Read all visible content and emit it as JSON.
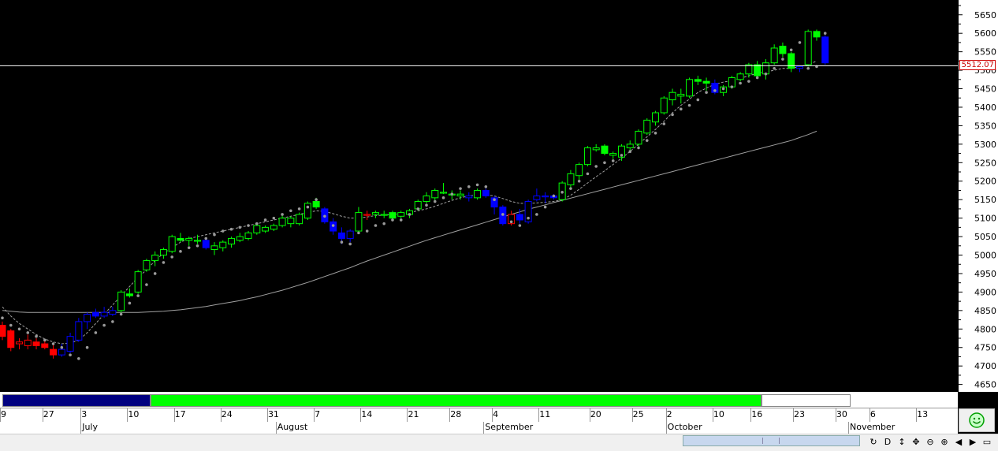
{
  "chart_data": {
    "type": "candlestick",
    "price_axis": {
      "ticks": [
        4650,
        4700,
        4750,
        4800,
        4850,
        4900,
        4950,
        5000,
        5050,
        5100,
        5150,
        5200,
        5250,
        5300,
        5350,
        5400,
        5450,
        5500,
        5550,
        5600,
        5650
      ],
      "min": 4630,
      "max": 5690
    },
    "current_price": 5512.07,
    "current_price_label": "5512.07",
    "candles": [
      {
        "o": 4810,
        "h": 4820,
        "l": 4770,
        "c": 4780,
        "color": "red"
      },
      {
        "o": 4795,
        "h": 4800,
        "l": 4740,
        "c": 4750,
        "color": "red"
      },
      {
        "o": 4760,
        "h": 4775,
        "l": 4745,
        "c": 4765,
        "color": "red"
      },
      {
        "o": 4755,
        "h": 4785,
        "l": 4745,
        "c": 4770,
        "color": "red"
      },
      {
        "o": 4765,
        "h": 4775,
        "l": 4745,
        "c": 4755,
        "color": "red"
      },
      {
        "o": 4760,
        "h": 4770,
        "l": 4745,
        "c": 4750,
        "color": "red"
      },
      {
        "o": 4745,
        "h": 4760,
        "l": 4720,
        "c": 4730,
        "color": "red"
      },
      {
        "o": 4730,
        "h": 4760,
        "l": 4725,
        "c": 4745,
        "color": "blue"
      },
      {
        "o": 4740,
        "h": 4790,
        "l": 4735,
        "c": 4780,
        "color": "blue"
      },
      {
        "o": 4770,
        "h": 4830,
        "l": 4765,
        "c": 4820,
        "color": "blue"
      },
      {
        "o": 4820,
        "h": 4845,
        "l": 4800,
        "c": 4840,
        "color": "blue"
      },
      {
        "o": 4845,
        "h": 4855,
        "l": 4830,
        "c": 4835,
        "color": "blue"
      },
      {
        "o": 4835,
        "h": 4860,
        "l": 4830,
        "c": 4845,
        "color": "blue"
      },
      {
        "o": 4840,
        "h": 4860,
        "l": 4835,
        "c": 4850,
        "color": "blue"
      },
      {
        "o": 4850,
        "h": 4905,
        "l": 4845,
        "c": 4900,
        "color": "green"
      },
      {
        "o": 4895,
        "h": 4910,
        "l": 4885,
        "c": 4890,
        "color": "green"
      },
      {
        "o": 4900,
        "h": 4960,
        "l": 4895,
        "c": 4955,
        "color": "green"
      },
      {
        "o": 4960,
        "h": 4990,
        "l": 4955,
        "c": 4985,
        "color": "green"
      },
      {
        "o": 4985,
        "h": 5010,
        "l": 4970,
        "c": 5000,
        "color": "green"
      },
      {
        "o": 5000,
        "h": 5020,
        "l": 4990,
        "c": 5015,
        "color": "green"
      },
      {
        "o": 5010,
        "h": 5055,
        "l": 5005,
        "c": 5050,
        "color": "green"
      },
      {
        "o": 5045,
        "h": 5060,
        "l": 5035,
        "c": 5040,
        "color": "green"
      },
      {
        "o": 5040,
        "h": 5050,
        "l": 5025,
        "c": 5045,
        "color": "green"
      },
      {
        "o": 5040,
        "h": 5055,
        "l": 5030,
        "c": 5040,
        "color": "green"
      },
      {
        "o": 5040,
        "h": 5045,
        "l": 5015,
        "c": 5020,
        "color": "blue"
      },
      {
        "o": 5015,
        "h": 5035,
        "l": 5000,
        "c": 5025,
        "color": "green"
      },
      {
        "o": 5020,
        "h": 5040,
        "l": 5010,
        "c": 5035,
        "color": "green"
      },
      {
        "o": 5030,
        "h": 5050,
        "l": 5020,
        "c": 5045,
        "color": "green"
      },
      {
        "o": 5040,
        "h": 5060,
        "l": 5035,
        "c": 5050,
        "color": "green"
      },
      {
        "o": 5045,
        "h": 5065,
        "l": 5040,
        "c": 5060,
        "color": "green"
      },
      {
        "o": 5060,
        "h": 5085,
        "l": 5055,
        "c": 5080,
        "color": "green"
      },
      {
        "o": 5065,
        "h": 5080,
        "l": 5060,
        "c": 5075,
        "color": "green"
      },
      {
        "o": 5070,
        "h": 5085,
        "l": 5065,
        "c": 5080,
        "color": "green"
      },
      {
        "o": 5080,
        "h": 5110,
        "l": 5075,
        "c": 5100,
        "color": "green"
      },
      {
        "o": 5085,
        "h": 5105,
        "l": 5075,
        "c": 5100,
        "color": "green"
      },
      {
        "o": 5085,
        "h": 5115,
        "l": 5080,
        "c": 5110,
        "color": "green"
      },
      {
        "o": 5100,
        "h": 5145,
        "l": 5095,
        "c": 5140,
        "color": "green"
      },
      {
        "o": 5145,
        "h": 5155,
        "l": 5125,
        "c": 5130,
        "color": "green"
      },
      {
        "o": 5125,
        "h": 5130,
        "l": 5085,
        "c": 5090,
        "color": "blue"
      },
      {
        "o": 5090,
        "h": 5100,
        "l": 5055,
        "c": 5065,
        "color": "blue"
      },
      {
        "o": 5060,
        "h": 5075,
        "l": 5030,
        "c": 5045,
        "color": "blue"
      },
      {
        "o": 5045,
        "h": 5070,
        "l": 5035,
        "c": 5065,
        "color": "blue"
      },
      {
        "o": 5065,
        "h": 5130,
        "l": 5060,
        "c": 5115,
        "color": "green"
      },
      {
        "o": 5110,
        "h": 5120,
        "l": 5095,
        "c": 5110,
        "color": "red"
      },
      {
        "o": 5110,
        "h": 5120,
        "l": 5100,
        "c": 5115,
        "color": "green"
      },
      {
        "o": 5110,
        "h": 5120,
        "l": 5100,
        "c": 5110,
        "color": "green"
      },
      {
        "o": 5115,
        "h": 5120,
        "l": 5095,
        "c": 5100,
        "color": "green"
      },
      {
        "o": 5105,
        "h": 5120,
        "l": 5100,
        "c": 5115,
        "color": "green"
      },
      {
        "o": 5110,
        "h": 5125,
        "l": 5100,
        "c": 5120,
        "color": "green"
      },
      {
        "o": 5125,
        "h": 5150,
        "l": 5120,
        "c": 5145,
        "color": "green"
      },
      {
        "o": 5145,
        "h": 5170,
        "l": 5140,
        "c": 5160,
        "color": "green"
      },
      {
        "o": 5155,
        "h": 5180,
        "l": 5145,
        "c": 5175,
        "color": "green"
      },
      {
        "o": 5170,
        "h": 5195,
        "l": 5165,
        "c": 5170,
        "color": "green"
      },
      {
        "o": 5165,
        "h": 5175,
        "l": 5150,
        "c": 5165,
        "color": "green"
      },
      {
        "o": 5160,
        "h": 5175,
        "l": 5150,
        "c": 5165,
        "color": "green"
      },
      {
        "o": 5155,
        "h": 5170,
        "l": 5145,
        "c": 5160,
        "color": "blue"
      },
      {
        "o": 5155,
        "h": 5180,
        "l": 5150,
        "c": 5175,
        "color": "green"
      },
      {
        "o": 5175,
        "h": 5180,
        "l": 5155,
        "c": 5160,
        "color": "blue"
      },
      {
        "o": 5155,
        "h": 5160,
        "l": 5110,
        "c": 5130,
        "color": "blue"
      },
      {
        "o": 5130,
        "h": 5135,
        "l": 5080,
        "c": 5085,
        "color": "blue"
      },
      {
        "o": 5085,
        "h": 5120,
        "l": 5080,
        "c": 5110,
        "color": "red"
      },
      {
        "o": 5110,
        "h": 5125,
        "l": 5085,
        "c": 5095,
        "color": "blue"
      },
      {
        "o": 5090,
        "h": 5150,
        "l": 5085,
        "c": 5145,
        "color": "blue"
      },
      {
        "o": 5150,
        "h": 5180,
        "l": 5145,
        "c": 5160,
        "color": "blue"
      },
      {
        "o": 5160,
        "h": 5170,
        "l": 5140,
        "c": 5160,
        "color": "blue"
      },
      {
        "o": 5160,
        "h": 5165,
        "l": 5150,
        "c": 5155,
        "color": "blue"
      },
      {
        "o": 5150,
        "h": 5200,
        "l": 5145,
        "c": 5195,
        "color": "green"
      },
      {
        "o": 5190,
        "h": 5230,
        "l": 5180,
        "c": 5220,
        "color": "green"
      },
      {
        "o": 5215,
        "h": 5250,
        "l": 5200,
        "c": 5245,
        "color": "green"
      },
      {
        "o": 5245,
        "h": 5295,
        "l": 5240,
        "c": 5290,
        "color": "green"
      },
      {
        "o": 5285,
        "h": 5300,
        "l": 5280,
        "c": 5290,
        "color": "green"
      },
      {
        "o": 5295,
        "h": 5300,
        "l": 5270,
        "c": 5275,
        "color": "green"
      },
      {
        "o": 5270,
        "h": 5280,
        "l": 5260,
        "c": 5275,
        "color": "green"
      },
      {
        "o": 5265,
        "h": 5300,
        "l": 5255,
        "c": 5295,
        "color": "green"
      },
      {
        "o": 5290,
        "h": 5310,
        "l": 5280,
        "c": 5300,
        "color": "green"
      },
      {
        "o": 5300,
        "h": 5340,
        "l": 5290,
        "c": 5335,
        "color": "green"
      },
      {
        "o": 5330,
        "h": 5370,
        "l": 5325,
        "c": 5365,
        "color": "green"
      },
      {
        "o": 5360,
        "h": 5390,
        "l": 5350,
        "c": 5385,
        "color": "green"
      },
      {
        "o": 5385,
        "h": 5430,
        "l": 5380,
        "c": 5425,
        "color": "green"
      },
      {
        "o": 5420,
        "h": 5450,
        "l": 5405,
        "c": 5440,
        "color": "green"
      },
      {
        "o": 5430,
        "h": 5450,
        "l": 5410,
        "c": 5435,
        "color": "green"
      },
      {
        "o": 5430,
        "h": 5480,
        "l": 5425,
        "c": 5475,
        "color": "green"
      },
      {
        "o": 5475,
        "h": 5485,
        "l": 5460,
        "c": 5470,
        "color": "green"
      },
      {
        "o": 5470,
        "h": 5480,
        "l": 5445,
        "c": 5465,
        "color": "green"
      },
      {
        "o": 5465,
        "h": 5475,
        "l": 5435,
        "c": 5440,
        "color": "blue"
      },
      {
        "o": 5440,
        "h": 5460,
        "l": 5430,
        "c": 5455,
        "color": "green"
      },
      {
        "o": 5455,
        "h": 5485,
        "l": 5450,
        "c": 5480,
        "color": "green"
      },
      {
        "o": 5475,
        "h": 5495,
        "l": 5470,
        "c": 5490,
        "color": "green"
      },
      {
        "o": 5490,
        "h": 5520,
        "l": 5480,
        "c": 5515,
        "color": "green"
      },
      {
        "o": 5515,
        "h": 5525,
        "l": 5480,
        "c": 5485,
        "color": "green"
      },
      {
        "o": 5490,
        "h": 5530,
        "l": 5475,
        "c": 5520,
        "color": "green"
      },
      {
        "o": 5520,
        "h": 5570,
        "l": 5515,
        "c": 5560,
        "color": "green"
      },
      {
        "o": 5565,
        "h": 5575,
        "l": 5535,
        "c": 5545,
        "color": "green"
      },
      {
        "o": 5545,
        "h": 5550,
        "l": 5495,
        "c": 5505,
        "color": "green"
      },
      {
        "o": 5505,
        "h": 5510,
        "l": 5495,
        "c": 5510,
        "color": "blue"
      },
      {
        "o": 5515,
        "h": 5610,
        "l": 5510,
        "c": 5605,
        "color": "green"
      },
      {
        "o": 5605,
        "h": 5610,
        "l": 5580,
        "c": 5590,
        "color": "green"
      },
      {
        "o": 5590,
        "h": 5595,
        "l": 5515,
        "c": 5520,
        "color": "blue"
      }
    ],
    "sar": [
      4830,
      4810,
      4800,
      4790,
      4780,
      4770,
      4760,
      4750,
      4730,
      4720,
      4750,
      4790,
      4810,
      4820,
      4840,
      4870,
      4890,
      4920,
      4950,
      4980,
      4995,
      5010,
      5020,
      5025,
      5045,
      5055,
      5065,
      5070,
      5075,
      5080,
      5085,
      5095,
      5100,
      5110,
      5120,
      5125,
      5130,
      5150,
      5105,
      5080,
      5035,
      5030,
      5060,
      5065,
      5080,
      5085,
      5095,
      5095,
      5110,
      5125,
      5135,
      5145,
      5155,
      5165,
      5180,
      5185,
      5190,
      5185,
      5150,
      5110,
      5090,
      5080,
      5100,
      5110,
      5130,
      5160,
      5170,
      5180,
      5200,
      5220,
      5240,
      5250,
      5255,
      5270,
      5280,
      5290,
      5310,
      5330,
      5355,
      5380,
      5395,
      5405,
      5420,
      5440,
      5445,
      5450,
      5455,
      5465,
      5470,
      5480,
      5490,
      5505,
      5530,
      5555,
      5575,
      5505,
      5510,
      5600
    ],
    "short_ma": [
      4860,
      4835,
      4815,
      4800,
      4785,
      4773,
      4765,
      4760,
      4762,
      4770,
      4790,
      4815,
      4840,
      4865,
      4890,
      4915,
      4940,
      4960,
      4985,
      5005,
      5020,
      5035,
      5045,
      5050,
      5055,
      5060,
      5065,
      5070,
      5075,
      5080,
      5085,
      5090,
      5095,
      5100,
      5105,
      5110,
      5115,
      5120,
      5118,
      5112,
      5105,
      5100,
      5100,
      5103,
      5107,
      5108,
      5110,
      5112,
      5115,
      5120,
      5125,
      5132,
      5140,
      5148,
      5155,
      5160,
      5163,
      5163,
      5160,
      5153,
      5145,
      5140,
      5140,
      5141,
      5143,
      5145,
      5150,
      5162,
      5178,
      5195,
      5212,
      5228,
      5245,
      5262,
      5280,
      5300,
      5320,
      5340,
      5362,
      5385,
      5405,
      5422,
      5440,
      5452,
      5462,
      5468,
      5472,
      5478,
      5485,
      5492,
      5496,
      5500,
      5505,
      5505,
      5510,
      5515,
      5525
    ],
    "long_ma": [
      4850,
      4848,
      4846,
      4845,
      4845,
      4845,
      4845,
      4845,
      4845,
      4845,
      4845,
      4845,
      4845,
      4845,
      4845,
      4845,
      4845,
      4846,
      4847,
      4848,
      4850,
      4852,
      4855,
      4858,
      4861,
      4865,
      4869,
      4873,
      4877,
      4882,
      4887,
      4893,
      4899,
      4905,
      4912,
      4919,
      4926,
      4934,
      4942,
      4950,
      4958,
      4966,
      4975,
      4984,
      4992,
      5000,
      5008,
      5016,
      5024,
      5032,
      5040,
      5047,
      5054,
      5061,
      5068,
      5075,
      5082,
      5089,
      5096,
      5103,
      5110,
      5117,
      5124,
      5130,
      5136,
      5142,
      5148,
      5154,
      5160,
      5166,
      5172,
      5178,
      5184,
      5190,
      5196,
      5202,
      5208,
      5214,
      5220,
      5226,
      5232,
      5238,
      5244,
      5250,
      5256,
      5262,
      5268,
      5274,
      5280,
      5286,
      5292,
      5298,
      5304,
      5310,
      5318,
      5326,
      5335
    ]
  },
  "band": [
    {
      "color": "#000080",
      "from": 0,
      "to": 17.5
    },
    {
      "color": "#00ff00",
      "from": 17.5,
      "to": 89.5
    },
    {
      "color": "#ffffff",
      "from": 89.5,
      "to": 100
    }
  ],
  "date_labels": [
    "9",
    "27",
    "3",
    "10",
    "17",
    "24",
    "31",
    "7",
    "14",
    "21",
    "28",
    "4",
    "11",
    "20",
    "25",
    "2",
    "10",
    "16",
    "23",
    "30",
    "6",
    "13"
  ],
  "month_labels": [
    "July",
    "August",
    "September",
    "October",
    "November"
  ],
  "toolbar_icons": [
    "reload-icon",
    "d-icon",
    "updown-arrow-icon",
    "move-icon",
    "zoom-out-icon",
    "zoom-in-icon",
    "left-arrow-icon",
    "right-arrow-icon",
    "window-icon"
  ],
  "toolbar_glyphs": [
    "↻",
    "D",
    "↕",
    "✥",
    "⊖",
    "⊕",
    "◀",
    "▶",
    "▭"
  ]
}
